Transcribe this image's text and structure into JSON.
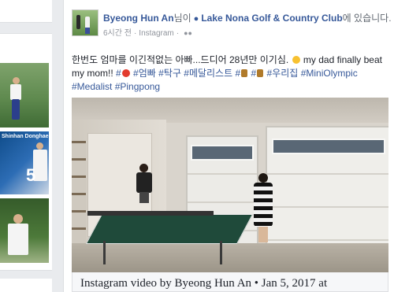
{
  "post": {
    "author": "Byeong Hun An",
    "suffix_before_place": "님이",
    "place": "Lake Nona Golf & Country Club",
    "suffix_after_place": "에 있습니다.",
    "time": "6시간 전",
    "source": "Instagram",
    "audience_icon": "friends-icon",
    "text": {
      "part1": "한번도 엄마를 이긴적없는 아빠...드디어 28년만 이기심.",
      "part2": "my dad finally beat my mom!!",
      "tag1": "#",
      "tag2": "#엄빠",
      "tag3": "#탁구",
      "tag4": "#메달리스트",
      "tag5": "#",
      "tag6": "#",
      "tag7": "#우리집",
      "tag8": "#MiniOlympic",
      "tag9": "#Medalist",
      "tag10": "#Pingpong"
    },
    "video_caption": "Instagram video by Byeong Hun An • Jan 5, 2017 at"
  },
  "left_column": {
    "sponsor_text": "Shinhan\nDonghae",
    "badge_number": "5"
  },
  "colors": {
    "link": "#365899",
    "background": "#e9ebee",
    "card": "#ffffff"
  }
}
